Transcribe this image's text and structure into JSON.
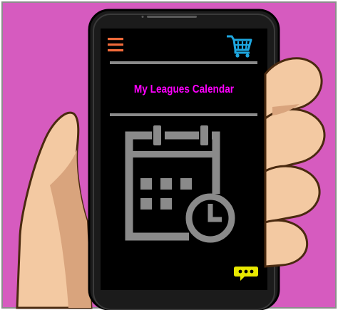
{
  "app": {
    "title": "My Leagues Calendar"
  },
  "icons": {
    "menu": "hamburger-menu-icon",
    "cart": "shopping-cart-icon",
    "calendar": "calendar-clock-icon",
    "chat": "chat-bubble-icon"
  },
  "colors": {
    "background": "#d65bbf",
    "screen": "#000000",
    "title": "#ff00ff",
    "menu_icon": "#f06a3a",
    "cart_icon": "#1ea7e0",
    "chat_icon": "#e8e800",
    "illustration_gray": "#8a8a8a",
    "skin": "#f3c9a2"
  }
}
